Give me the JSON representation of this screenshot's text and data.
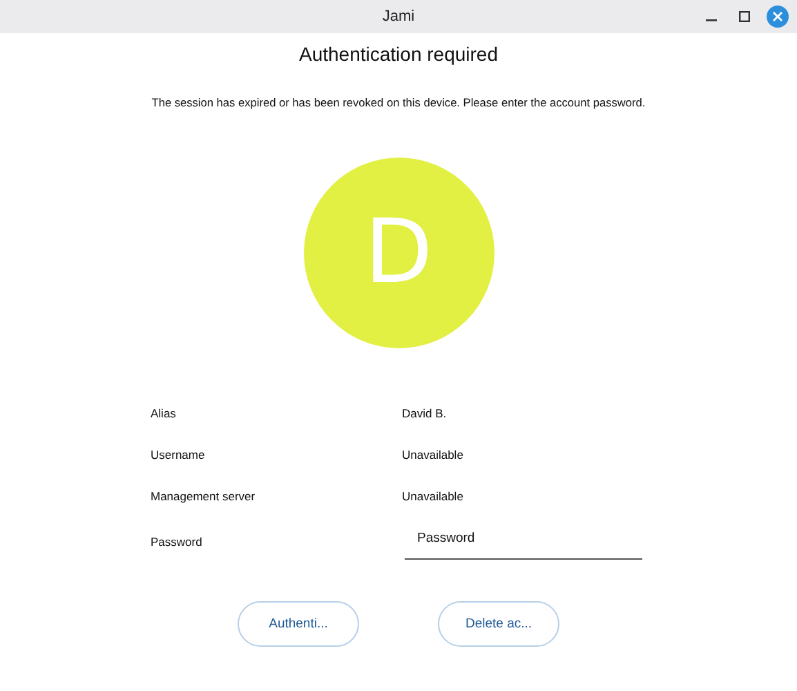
{
  "window": {
    "title": "Jami"
  },
  "heading": "Authentication required",
  "message": "The session has expired or has been revoked on this device. Please enter the account password.",
  "avatar": {
    "initial": "D",
    "color": "#e2f043"
  },
  "details": [
    {
      "label": "Alias",
      "value": "David B."
    },
    {
      "label": "Username",
      "value": "Unavailable"
    },
    {
      "label": "Management server",
      "value": "Unavailable"
    }
  ],
  "password": {
    "label": "Password",
    "placeholder": "Password"
  },
  "buttons": [
    "Authenti...",
    "Delete ac..."
  ]
}
